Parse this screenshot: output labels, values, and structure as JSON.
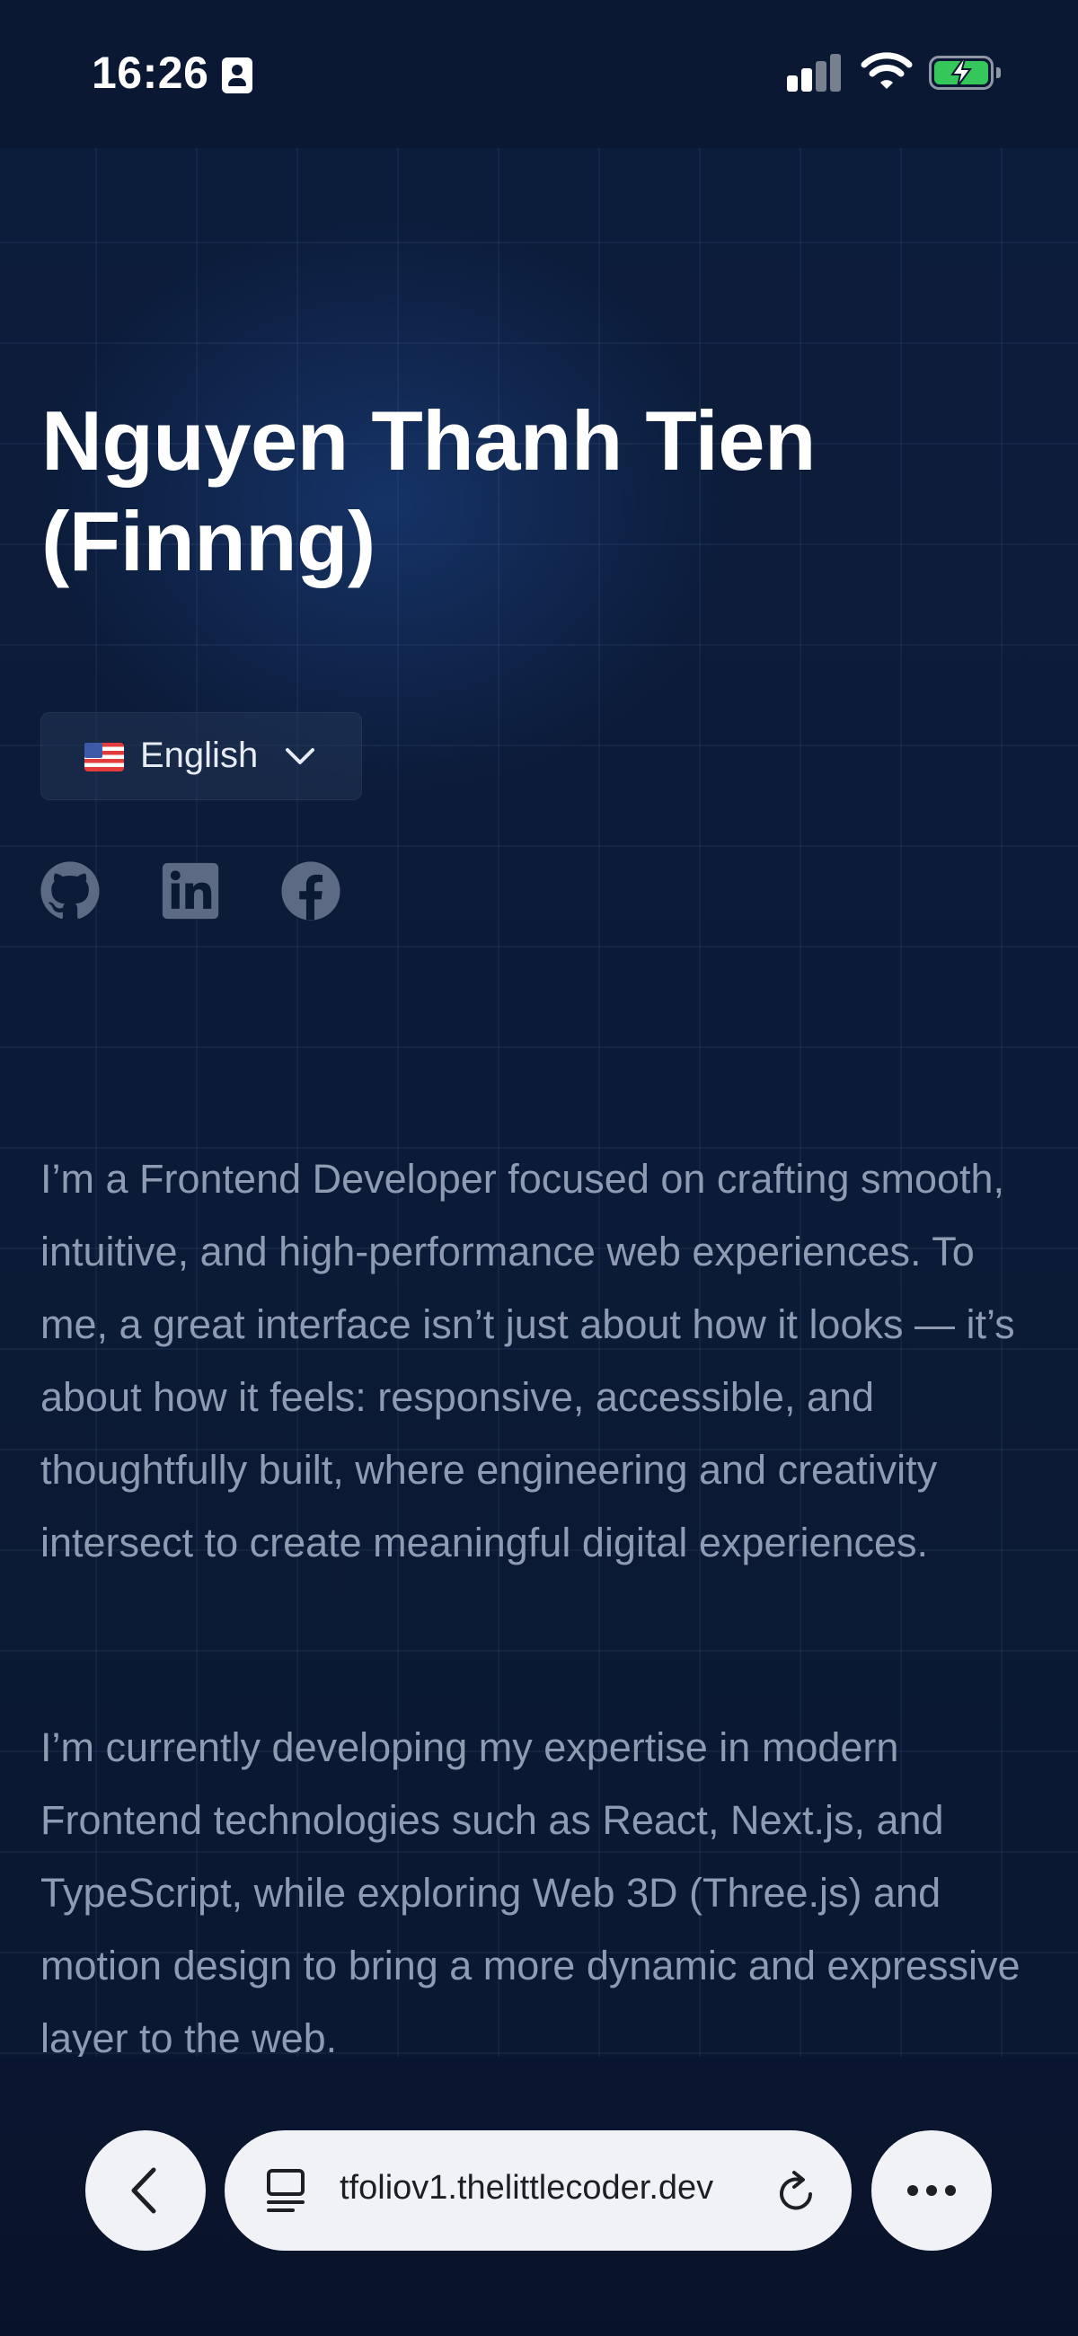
{
  "status_bar": {
    "time": "16:26"
  },
  "hero": {
    "name": "Nguyen Thanh Tien (Finnng)",
    "language": {
      "flag": "🇺🇸",
      "label": "English"
    },
    "social_links": [
      {
        "name": "github",
        "icon": "github-icon"
      },
      {
        "name": "linkedin",
        "icon": "linkedin-icon"
      },
      {
        "name": "facebook",
        "icon": "facebook-icon"
      }
    ]
  },
  "about": {
    "paragraph_1": "I’m a Frontend Developer focused on crafting smooth, intuitive, and high-performance web experiences. To me, a great interface isn’t just about how it looks — it’s about how it feels: responsive, accessible, and thoughtfully built, where engineering and creativity intersect to create meaningful digital experiences.",
    "paragraph_2": "I’m currently developing my expertise in modern Frontend technologies such as React, Next.js, and TypeScript, while exploring Web 3D (Three.js) and motion design to bring a more dynamic and expressive layer to the web."
  },
  "browser": {
    "url": "tfoliov1.thelittlecoder.dev"
  },
  "colors": {
    "background": "#0b1a33",
    "text_muted": "#8e9bb3",
    "icon_muted": "#5d6a83",
    "battery": "#35c759"
  }
}
